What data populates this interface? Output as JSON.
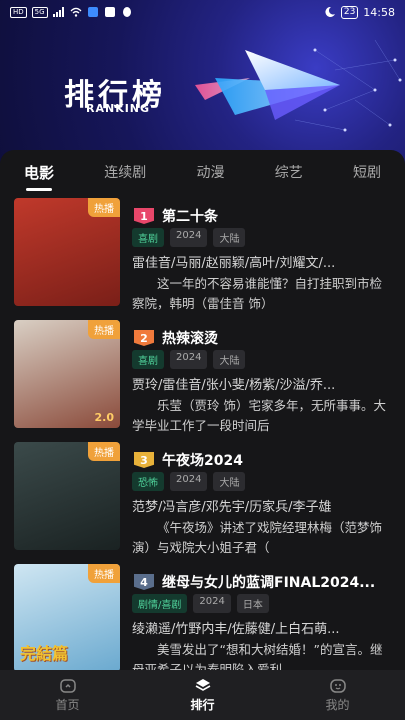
{
  "status_bar": {
    "left_chips": [
      "HD",
      "5G"
    ],
    "time": "14:58",
    "battery": "23"
  },
  "header": {
    "title": "排行榜",
    "subtitle": "RANKING"
  },
  "tabs": [
    {
      "label": "电影",
      "active": true
    },
    {
      "label": "连续剧",
      "active": false
    },
    {
      "label": "动漫",
      "active": false
    },
    {
      "label": "综艺",
      "active": false
    },
    {
      "label": "短剧",
      "active": false
    }
  ],
  "items": [
    {
      "rank": "1",
      "rank_color": "#e8476a",
      "badge": "热播",
      "score": "",
      "title": "第二十条",
      "genre": "喜剧",
      "year": "2024",
      "region": "大陆",
      "cast": "雷佳音/马丽/赵丽颖/高叶/刘耀文/...",
      "desc": "这一年的不容易谁能懂？自打挂职到市检察院，韩明（雷佳音 饰）",
      "poster_colors": [
        "#c0392b",
        "#7a1f18"
      ]
    },
    {
      "rank": "2",
      "rank_color": "#f07a3c",
      "badge": "热播",
      "score": "2.0",
      "title": "热辣滚烫",
      "genre": "喜剧",
      "year": "2024",
      "region": "大陆",
      "cast": "贾玲/雷佳音/张小斐/杨紫/沙溢/乔...",
      "desc": "乐莹（贾玲 饰）宅家多年，无所事事。大学毕业工作了一段时间后",
      "poster_colors": [
        "#d9cfc4",
        "#8a4a3a"
      ]
    },
    {
      "rank": "3",
      "rank_color": "#e8b23a",
      "badge": "热播",
      "score": "",
      "title": "午夜场2024",
      "genre": "恐怖",
      "year": "2024",
      "region": "大陆",
      "cast": "范梦/冯言彦/邓先宇/历家兵/李子雄",
      "desc": "《午夜场》讲述了戏院经理林梅（范梦饰演）与戏院大小姐子君（",
      "poster_colors": [
        "#3b4a4a",
        "#1a2222"
      ]
    },
    {
      "rank": "4",
      "rank_color": "#5a6e8c",
      "badge": "热播",
      "score": "",
      "title": "继母与女儿的蓝调FINAL2024...",
      "genre": "剧情/喜剧",
      "year": "2024",
      "region": "日本",
      "cast": "绫濑遥/竹野内丰/佐藤健/上白石萌...",
      "desc": "美雪发出了“想和大树结婚！”的宣言。继母亚希子以为泰明陷入爱利",
      "poster_colors": [
        "#cfe6f2",
        "#6aa9cf"
      ],
      "poster_text": "完結篇"
    }
  ],
  "bottom_nav": [
    {
      "label": "首页",
      "icon": "home-icon",
      "active": false
    },
    {
      "label": "排行",
      "icon": "ranking-icon",
      "active": true
    },
    {
      "label": "我的",
      "icon": "profile-icon",
      "active": false
    }
  ]
}
